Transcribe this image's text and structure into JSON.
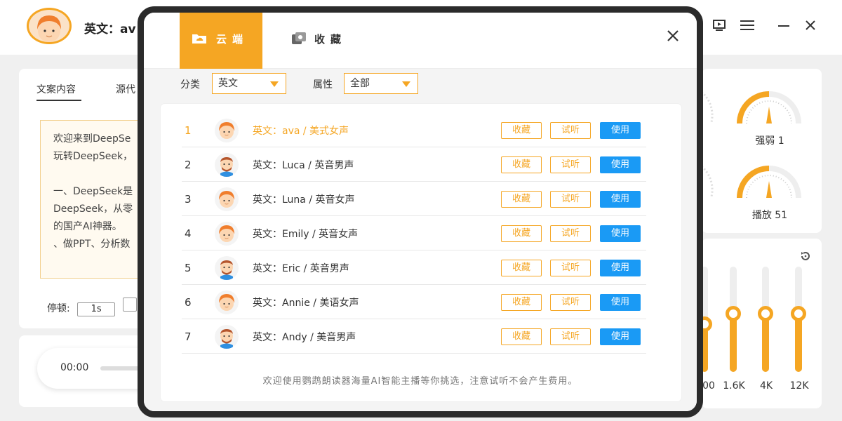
{
  "app": {
    "voice_title": "英文：av",
    "window_icons": [
      "screen-icon",
      "menu-icon",
      "minimize-icon",
      "close-icon"
    ]
  },
  "left_panel": {
    "tabs": [
      "文案内容",
      "源代"
    ],
    "text_lines": [
      "欢迎来到DeepSe",
      "玩转DeepSeek，",
      "",
      "一、DeepSeek是",
      "DeepSeek，从零",
      "的国产AI神器。",
      "、做PPT、分析数"
    ],
    "pause_label": "停顿:",
    "pause_value": "1s"
  },
  "player": {
    "time": "00:00"
  },
  "right_panel": {
    "gauges": [
      {
        "label": "强弱 1",
        "value": 1
      },
      {
        "label": "播放 51",
        "value": 51
      }
    ],
    "eq": [
      {
        "label": "00",
        "level": 0.45
      },
      {
        "label": "1.6K",
        "level": 0.55
      },
      {
        "label": "4K",
        "level": 0.55
      },
      {
        "label": "12K",
        "level": 0.55
      }
    ]
  },
  "modal": {
    "tabs": {
      "cloud": "云端",
      "favorites": "收藏"
    },
    "filters": {
      "category_label": "分类",
      "category_value": "英文",
      "attribute_label": "属性",
      "attribute_value": "全部"
    },
    "rows": [
      {
        "num": "1",
        "name": "英文：ava / 美式女声",
        "gender": "female",
        "active": true
      },
      {
        "num": "2",
        "name": "英文：Luca / 英音男声",
        "gender": "male",
        "active": false
      },
      {
        "num": "3",
        "name": "英文：Luna / 英音女声",
        "gender": "female",
        "active": false
      },
      {
        "num": "4",
        "name": "英文：Emily / 英音女声",
        "gender": "female",
        "active": false
      },
      {
        "num": "5",
        "name": "英文：Eric / 英音男声",
        "gender": "male",
        "active": false
      },
      {
        "num": "6",
        "name": "英文：Annie / 美语女声",
        "gender": "female",
        "active": false
      },
      {
        "num": "7",
        "name": "英文：Andy / 美音男声",
        "gender": "male",
        "active": false
      }
    ],
    "buttons": {
      "favorite": "收藏",
      "try": "试听",
      "use": "使用"
    },
    "footer": "欢迎使用鹦鹉朗读器海量AI智能主播等你挑选，注意试听不会产生费用。"
  },
  "colors": {
    "accent": "#f5a623",
    "primary": "#1a9af5"
  }
}
